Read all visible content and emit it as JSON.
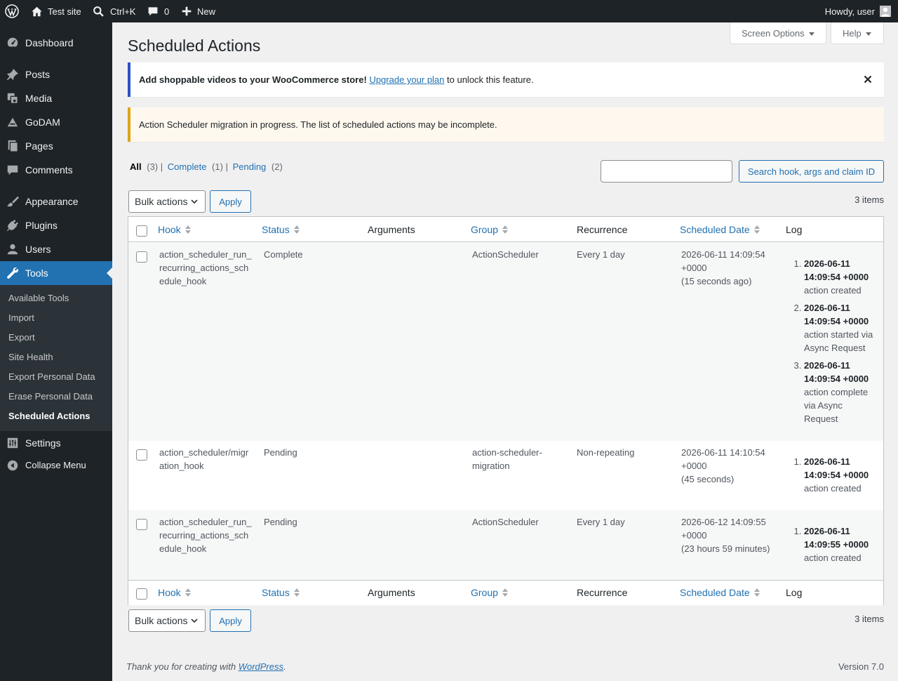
{
  "adminbar": {
    "site_name": "Test site",
    "search_shortcut": "Ctrl+K",
    "comments_count": "0",
    "new_label": "New",
    "howdy": "Howdy, user"
  },
  "sidebar": {
    "items": [
      {
        "label": "Dashboard",
        "icon": "dashboard-icon"
      },
      {
        "label": "Posts",
        "icon": "pin-icon"
      },
      {
        "label": "Media",
        "icon": "media-icon"
      },
      {
        "label": "GoDAM",
        "icon": "godam-icon"
      },
      {
        "label": "Pages",
        "icon": "pages-icon"
      },
      {
        "label": "Comments",
        "icon": "comments-icon"
      },
      {
        "label": "Appearance",
        "icon": "brush-icon"
      },
      {
        "label": "Plugins",
        "icon": "plug-icon"
      },
      {
        "label": "Users",
        "icon": "user-icon"
      },
      {
        "label": "Tools",
        "icon": "wrench-icon"
      },
      {
        "label": "Settings",
        "icon": "sliders-icon"
      },
      {
        "label": "Collapse Menu",
        "icon": "collapse-icon"
      }
    ],
    "submenu": [
      "Available Tools",
      "Import",
      "Export",
      "Site Health",
      "Export Personal Data",
      "Erase Personal Data",
      "Scheduled Actions"
    ]
  },
  "tabs": {
    "screen_options": "Screen Options",
    "help": "Help"
  },
  "page_title": "Scheduled Actions",
  "notices": {
    "info_bold": "Add shoppable videos to your WooCommerce store!",
    "info_link": "Upgrade your plan",
    "info_rest": " to unlock this feature.",
    "warning": "Action Scheduler migration in progress. The list of scheduled actions may be incomplete."
  },
  "filters": {
    "all": "All",
    "all_count": "(3)",
    "complete": "Complete",
    "complete_count": "(1)",
    "pending": "Pending",
    "pending_count": "(2)",
    "sep": "|"
  },
  "search": {
    "placeholder": "",
    "button": "Search hook, args and claim ID"
  },
  "bulk": {
    "label": "Bulk actions",
    "apply": "Apply",
    "items": "3 items"
  },
  "columns": {
    "hook": "Hook",
    "status": "Status",
    "arguments": "Arguments",
    "group": "Group",
    "recurrence": "Recurrence",
    "scheduled_date": "Scheduled Date",
    "log": "Log"
  },
  "rows": [
    {
      "hook": "action_scheduler_run_recurring_actions_schedule_hook",
      "status": "Complete",
      "arguments": "",
      "group": "ActionScheduler",
      "recurrence": "Every 1 day",
      "date": "2026-06-11 14:09:54 +0000",
      "date_rel": "(15 seconds ago)",
      "log": [
        {
          "time": "2026-06-11 14:09:54 +0000",
          "msg": "action created"
        },
        {
          "time": "2026-06-11 14:09:54 +0000",
          "msg": "action started via Async Request"
        },
        {
          "time": "2026-06-11 14:09:54 +0000",
          "msg": "action complete via Async Request"
        }
      ]
    },
    {
      "hook": "action_scheduler/migration_hook",
      "status": "Pending",
      "arguments": "",
      "group": "action-scheduler-migration",
      "recurrence": "Non-repeating",
      "date": "2026-06-11 14:10:54 +0000",
      "date_rel": "(45 seconds)",
      "log": [
        {
          "time": "2026-06-11 14:09:54 +0000",
          "msg": "action created"
        }
      ]
    },
    {
      "hook": "action_scheduler_run_recurring_actions_schedule_hook",
      "status": "Pending",
      "arguments": "",
      "group": "ActionScheduler",
      "recurrence": "Every 1 day",
      "date": "2026-06-12 14:09:55 +0000",
      "date_rel": "(23 hours 59 minutes)",
      "log": [
        {
          "time": "2026-06-11 14:09:55 +0000",
          "msg": "action created"
        }
      ]
    }
  ],
  "footer": {
    "thanks_pre": "Thank you for creating with ",
    "thanks_link": "WordPress",
    "thanks_post": ".",
    "version": "Version 7.0"
  }
}
